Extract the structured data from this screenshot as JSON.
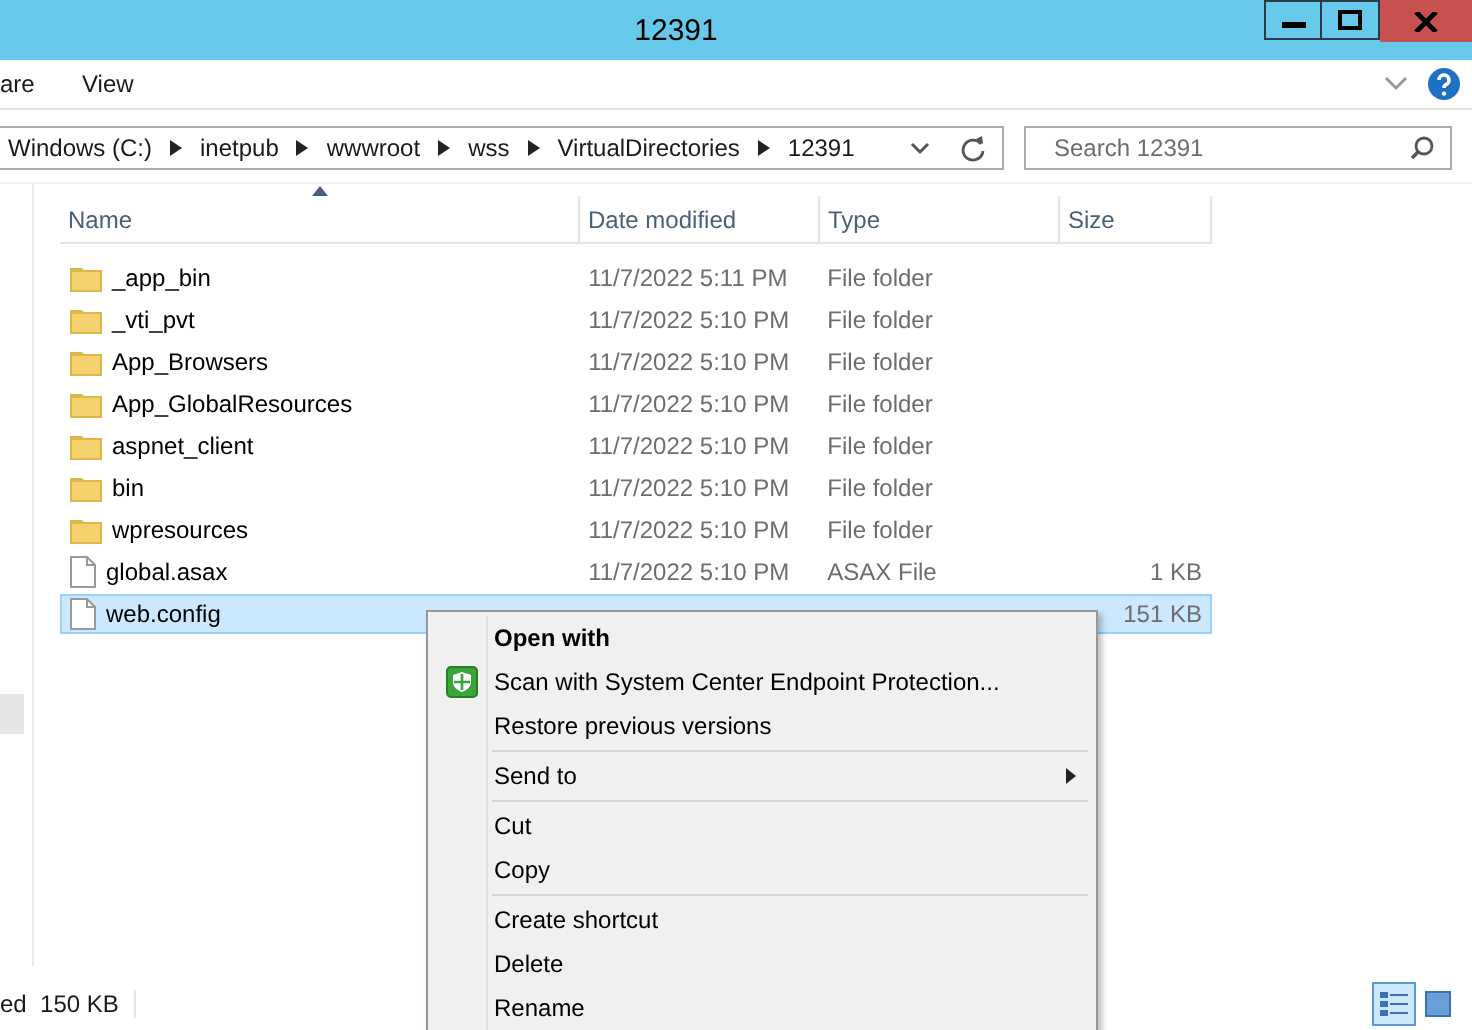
{
  "window": {
    "title": "12391"
  },
  "ribbon": {
    "tabs": [
      "are",
      "View"
    ]
  },
  "address": {
    "segments": [
      "Windows (C:)",
      "inetpub",
      "wwwroot",
      "wss",
      "VirtualDirectories",
      "12391"
    ]
  },
  "search": {
    "placeholder": "Search 12391"
  },
  "columns": [
    "Name",
    "Date modified",
    "Type",
    "Size"
  ],
  "rows": [
    {
      "kind": "folder",
      "name": "_app_bin",
      "date": "11/7/2022 5:11 PM",
      "type": "File folder",
      "size": "",
      "selected": false
    },
    {
      "kind": "folder",
      "name": "_vti_pvt",
      "date": "11/7/2022 5:10 PM",
      "type": "File folder",
      "size": "",
      "selected": false
    },
    {
      "kind": "folder",
      "name": "App_Browsers",
      "date": "11/7/2022 5:10 PM",
      "type": "File folder",
      "size": "",
      "selected": false
    },
    {
      "kind": "folder",
      "name": "App_GlobalResources",
      "date": "11/7/2022 5:10 PM",
      "type": "File folder",
      "size": "",
      "selected": false
    },
    {
      "kind": "folder",
      "name": "aspnet_client",
      "date": "11/7/2022 5:10 PM",
      "type": "File folder",
      "size": "",
      "selected": false
    },
    {
      "kind": "folder",
      "name": "bin",
      "date": "11/7/2022 5:10 PM",
      "type": "File folder",
      "size": "",
      "selected": false
    },
    {
      "kind": "folder",
      "name": "wpresources",
      "date": "11/7/2022 5:10 PM",
      "type": "File folder",
      "size": "",
      "selected": false
    },
    {
      "kind": "file",
      "name": "global.asax",
      "date": "11/7/2022 5:10 PM",
      "type": "ASAX File",
      "size": "1 KB",
      "selected": false
    },
    {
      "kind": "file",
      "name": "web.config",
      "size": "151 KB",
      "selected": true
    }
  ],
  "context_menu": [
    {
      "kind": "item",
      "label": "Open with",
      "bold": true
    },
    {
      "kind": "shield_item",
      "label": "Scan with System Center Endpoint Protection...",
      "bold": false
    },
    {
      "kind": "item",
      "label": "Restore previous versions",
      "bold": false
    },
    {
      "kind": "separator"
    },
    {
      "kind": "submenu",
      "label": "Send to",
      "bold": false
    },
    {
      "kind": "separator"
    },
    {
      "kind": "item",
      "label": "Cut",
      "bold": false
    },
    {
      "kind": "item",
      "label": "Copy",
      "bold": false
    },
    {
      "kind": "separator"
    },
    {
      "kind": "item",
      "label": "Create shortcut",
      "bold": false
    },
    {
      "kind": "item",
      "label": "Delete",
      "bold": false
    },
    {
      "kind": "item",
      "label": "Rename",
      "bold": false
    }
  ],
  "status_bar": {
    "text": "ed  150 KB"
  },
  "views": [
    {
      "kind": "details",
      "selected": true
    },
    {
      "kind": "large",
      "selected": false
    }
  ]
}
